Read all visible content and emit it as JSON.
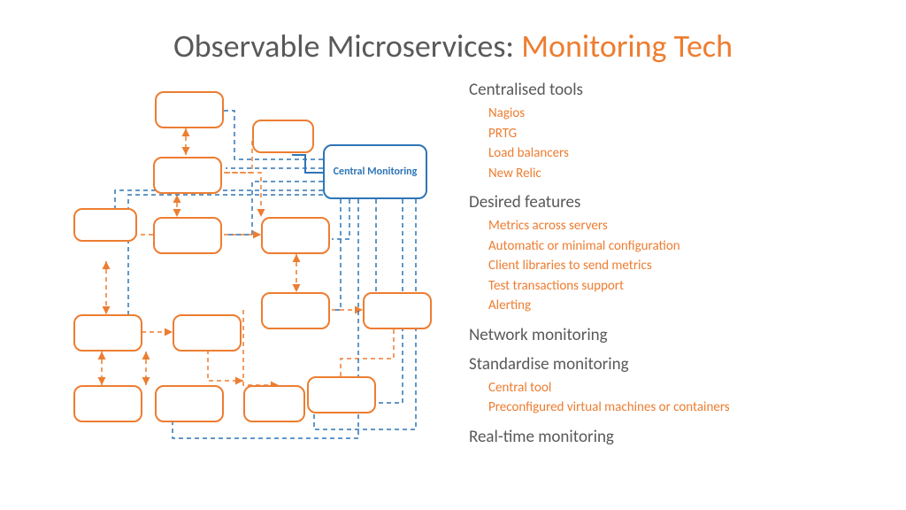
{
  "title": {
    "prefix": "Observable Microservices: ",
    "accent": "Monitoring Tech"
  },
  "diagram": {
    "central_label": "Central Monitoring"
  },
  "sections": [
    {
      "heading": "Centralised tools",
      "items": [
        "Nagios",
        "PRTG",
        "Load balancers",
        "New Relic"
      ]
    },
    {
      "heading": "Desired features",
      "items": [
        "Metrics across servers",
        "Automatic or minimal configuration",
        "Client libraries to send metrics",
        "Test transactions support",
        "Alerting"
      ]
    },
    {
      "heading": "Network monitoring",
      "items": []
    },
    {
      "heading": "Standardise monitoring",
      "items": [
        "Central tool",
        "Preconfigured virtual machines or containers"
      ]
    },
    {
      "heading": "Real-time monitoring",
      "items": []
    }
  ],
  "colors": {
    "accent": "#ed7d31",
    "text": "#595959",
    "blue": "#2e75b6"
  }
}
